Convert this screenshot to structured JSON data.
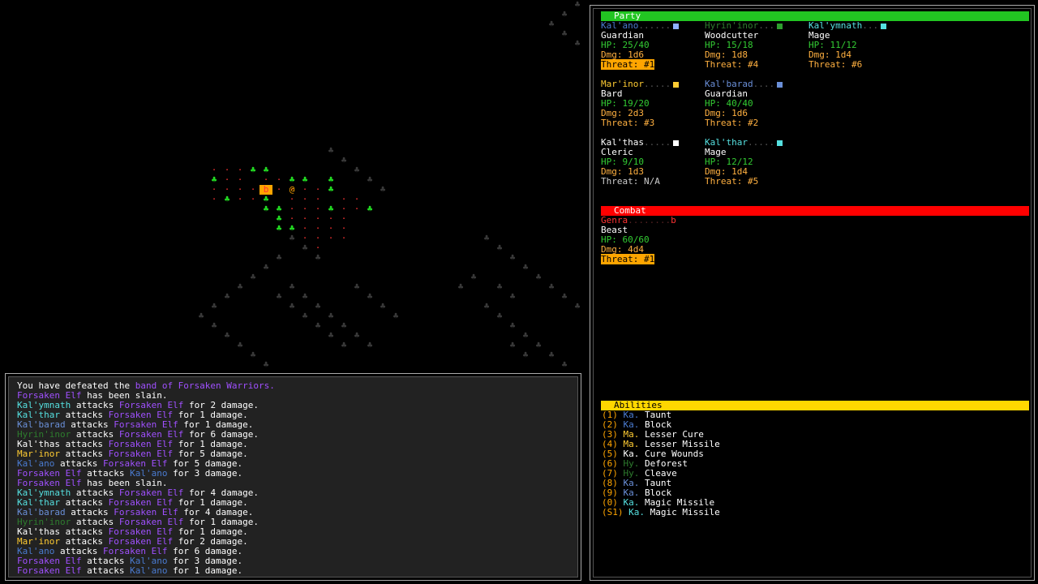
{
  "colors": {
    "party_header": "#22c522",
    "combat_header": "#ff0000",
    "abilities_header": "#ffd700",
    "cyan": "#55e0e0",
    "teal": "#3fbfbf",
    "green": "#2e8b2e",
    "yellow": "#ffcc33",
    "purple": "#a050ff",
    "blue": "#6a8fd8",
    "white": "#ffffff",
    "gray": "#bbbbbb",
    "red": "#ff3333",
    "hp_green": "#33cc33",
    "dmg_orange": "#ffb040",
    "threat_orange": "#ffa500"
  },
  "party": {
    "header": "Party",
    "members": [
      {
        "name": "Kal'ano",
        "name_color": "#4a7bd0",
        "dot": "#8fb0ff",
        "class": "Guardian",
        "hp": "HP: 25/40",
        "dmg": "Dmg: 1d6",
        "threat": "Threat: #1",
        "threat_hl": true
      },
      {
        "name": "Hyrin'inor",
        "name_color": "#2e7d2e",
        "dot": "#2e9d2e",
        "class": "Woodcutter",
        "hp": "HP: 15/18",
        "dmg": "Dmg: 1d8",
        "threat": "Threat: #4",
        "threat_hl": false
      },
      {
        "name": "Kal'ymnath",
        "name_color": "#55e0e0",
        "dot": "#55e0e0",
        "class": "Mage",
        "hp": "HP: 11/12",
        "dmg": "Dmg: 1d4",
        "threat": "Threat: #6",
        "threat_hl": false
      },
      {
        "name": "Mar'inor",
        "name_color": "#ffcc33",
        "dot": "#ffcc33",
        "class": "Bard",
        "hp": "HP: 19/20",
        "dmg": "Dmg: 2d3",
        "threat": "Threat: #3",
        "threat_hl": false
      },
      {
        "name": "Kal'barad",
        "name_color": "#6a8fd8",
        "dot": "#6a8fd8",
        "class": "Guardian",
        "hp": "HP: 40/40",
        "dmg": "Dmg: 1d6",
        "threat": "Threat: #2",
        "threat_hl": false
      },
      {
        "name": "Kal'thas",
        "name_color": "#ffffff",
        "dot": "#ffffff",
        "class": "Cleric",
        "hp": "HP: 9/10",
        "dmg": "Dmg: 1d3",
        "threat": "Threat: N/A",
        "threat_hl": false
      },
      {
        "name": "Kal'thar",
        "name_color": "#55e0e0",
        "dot": "#55e0e0",
        "class": "Mage",
        "hp": "HP: 12/12",
        "dmg": "Dmg: 1d4",
        "threat": "Threat: #5",
        "threat_hl": false
      }
    ]
  },
  "combat": {
    "header": "Combat",
    "enemy": {
      "name": "Genra",
      "glyph": "b",
      "type": "Beast",
      "hp": "HP: 60/60",
      "dmg": "Dmg: 4d4",
      "threat": "Threat: #1"
    }
  },
  "abilities": {
    "header": "Abilities",
    "items": [
      {
        "key": "(1)",
        "who": "Ka.",
        "who_color": "#4a7bd0",
        "name": "Taunt"
      },
      {
        "key": "(2)",
        "who": "Ka.",
        "who_color": "#4a7bd0",
        "name": "Block"
      },
      {
        "key": "(3)",
        "who": "Ma.",
        "who_color": "#ffcc33",
        "name": "Lesser Cure"
      },
      {
        "key": "(4)",
        "who": "Ma.",
        "who_color": "#ffcc33",
        "name": "Lesser Missile"
      },
      {
        "key": "(5)",
        "who": "Ka.",
        "who_color": "#ffffff",
        "name": "Cure Wounds"
      },
      {
        "key": "(6)",
        "who": "Hy.",
        "who_color": "#2e7d2e",
        "name": "Deforest"
      },
      {
        "key": "(7)",
        "who": "Hy.",
        "who_color": "#2e7d2e",
        "name": "Cleave"
      },
      {
        "key": "(8)",
        "who": "Ka.",
        "who_color": "#6a8fd8",
        "name": "Taunt"
      },
      {
        "key": "(9)",
        "who": "Ka.",
        "who_color": "#6a8fd8",
        "name": "Block"
      },
      {
        "key": "(0)",
        "who": "Ka.",
        "who_color": "#55e0e0",
        "name": "Magic Missile"
      },
      {
        "key": "(S1)",
        "who": "Ka.",
        "who_color": "#55e0e0",
        "name": "Magic Missile"
      }
    ]
  },
  "log": {
    "lines": [
      [
        {
          "t": "You have defeated the ",
          "c": "#ffffff"
        },
        {
          "t": "band of Forsaken Warriors.",
          "c": "#a050ff"
        }
      ],
      [
        {
          "t": "Forsaken Elf",
          "c": "#a050ff"
        },
        {
          "t": " has been slain.",
          "c": "#ffffff"
        }
      ],
      [
        {
          "t": "Kal'ymnath",
          "c": "#55e0e0"
        },
        {
          "t": " attacks ",
          "c": "#ffffff"
        },
        {
          "t": "Forsaken Elf",
          "c": "#a050ff"
        },
        {
          "t": " for 2 damage.",
          "c": "#ffffff"
        }
      ],
      [
        {
          "t": "Kal'thar",
          "c": "#55e0e0"
        },
        {
          "t": " attacks ",
          "c": "#ffffff"
        },
        {
          "t": "Forsaken Elf",
          "c": "#a050ff"
        },
        {
          "t": " for 1 damage.",
          "c": "#ffffff"
        }
      ],
      [
        {
          "t": "Kal'barad",
          "c": "#6a8fd8"
        },
        {
          "t": " attacks ",
          "c": "#ffffff"
        },
        {
          "t": "Forsaken Elf",
          "c": "#a050ff"
        },
        {
          "t": " for 1 damage.",
          "c": "#ffffff"
        }
      ],
      [
        {
          "t": "Hyrin'inor",
          "c": "#2e7d2e"
        },
        {
          "t": " attacks ",
          "c": "#ffffff"
        },
        {
          "t": "Forsaken Elf",
          "c": "#a050ff"
        },
        {
          "t": " for 6 damage.",
          "c": "#ffffff"
        }
      ],
      [
        {
          "t": "Kal'thas",
          "c": "#ffffff"
        },
        {
          "t": " attacks ",
          "c": "#ffffff"
        },
        {
          "t": "Forsaken Elf",
          "c": "#a050ff"
        },
        {
          "t": " for 1 damage.",
          "c": "#ffffff"
        }
      ],
      [
        {
          "t": "Mar'inor",
          "c": "#ffcc33"
        },
        {
          "t": " attacks ",
          "c": "#ffffff"
        },
        {
          "t": "Forsaken Elf",
          "c": "#a050ff"
        },
        {
          "t": " for 5 damage.",
          "c": "#ffffff"
        }
      ],
      [
        {
          "t": "Kal'ano",
          "c": "#4a7bd0"
        },
        {
          "t": " attacks ",
          "c": "#ffffff"
        },
        {
          "t": "Forsaken Elf",
          "c": "#a050ff"
        },
        {
          "t": " for 5 damage.",
          "c": "#ffffff"
        }
      ],
      [
        {
          "t": "Forsaken Elf",
          "c": "#a050ff"
        },
        {
          "t": " attacks ",
          "c": "#ffffff"
        },
        {
          "t": "Kal'ano",
          "c": "#4a7bd0"
        },
        {
          "t": " for 3 damage.",
          "c": "#ffffff"
        }
      ],
      [
        {
          "t": "Forsaken Elf",
          "c": "#a050ff"
        },
        {
          "t": " has been slain.",
          "c": "#ffffff"
        }
      ],
      [
        {
          "t": "Kal'ymnath",
          "c": "#55e0e0"
        },
        {
          "t": " attacks ",
          "c": "#ffffff"
        },
        {
          "t": "Forsaken Elf",
          "c": "#a050ff"
        },
        {
          "t": " for 4 damage.",
          "c": "#ffffff"
        }
      ],
      [
        {
          "t": "Kal'thar",
          "c": "#55e0e0"
        },
        {
          "t": " attacks ",
          "c": "#ffffff"
        },
        {
          "t": "Forsaken Elf",
          "c": "#a050ff"
        },
        {
          "t": " for 1 damage.",
          "c": "#ffffff"
        }
      ],
      [
        {
          "t": "Kal'barad",
          "c": "#6a8fd8"
        },
        {
          "t": " attacks ",
          "c": "#ffffff"
        },
        {
          "t": "Forsaken Elf",
          "c": "#a050ff"
        },
        {
          "t": " for 4 damage.",
          "c": "#ffffff"
        }
      ],
      [
        {
          "t": "Hyrin'inor",
          "c": "#2e7d2e"
        },
        {
          "t": " attacks ",
          "c": "#ffffff"
        },
        {
          "t": "Forsaken Elf",
          "c": "#a050ff"
        },
        {
          "t": " for 1 damage.",
          "c": "#ffffff"
        }
      ],
      [
        {
          "t": "Kal'thas",
          "c": "#ffffff"
        },
        {
          "t": " attacks ",
          "c": "#ffffff"
        },
        {
          "t": "Forsaken Elf",
          "c": "#a050ff"
        },
        {
          "t": " for 1 damage.",
          "c": "#ffffff"
        }
      ],
      [
        {
          "t": "Mar'inor",
          "c": "#ffcc33"
        },
        {
          "t": " attacks ",
          "c": "#ffffff"
        },
        {
          "t": "Forsaken Elf",
          "c": "#a050ff"
        },
        {
          "t": " for 2 damage.",
          "c": "#ffffff"
        }
      ],
      [
        {
          "t": "Kal'ano",
          "c": "#4a7bd0"
        },
        {
          "t": " attacks ",
          "c": "#ffffff"
        },
        {
          "t": "Forsaken Elf",
          "c": "#a050ff"
        },
        {
          "t": " for 6 damage.",
          "c": "#ffffff"
        }
      ],
      [
        {
          "t": "Forsaken Elf",
          "c": "#a050ff"
        },
        {
          "t": " attacks ",
          "c": "#ffffff"
        },
        {
          "t": "Kal'ano",
          "c": "#4a7bd0"
        },
        {
          "t": " for 3 damage.",
          "c": "#ffffff"
        }
      ],
      [
        {
          "t": "Forsaken Elf",
          "c": "#a050ff"
        },
        {
          "t": " attacks ",
          "c": "#ffffff"
        },
        {
          "t": "Kal'ano",
          "c": "#4a7bd0"
        },
        {
          "t": " for 1 damage.",
          "c": "#ffffff"
        }
      ]
    ]
  },
  "map": {
    "party_glyph": "@",
    "enemy_glyph": "b",
    "tree_glyph": "♣",
    "floor_glyph": "·",
    "party_color": "#ffa500",
    "enemy_bg": "#ffa500",
    "enemy_fg": "#ff3333",
    "tree_lit_color": "#22dd22",
    "tree_dark_color": "#3a3a3a",
    "path_color": "#ff3333"
  }
}
